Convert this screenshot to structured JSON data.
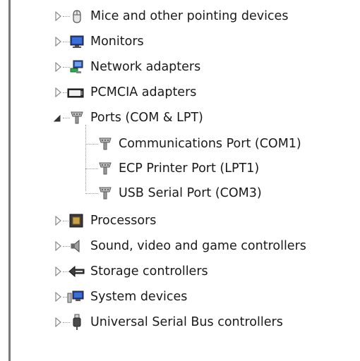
{
  "device_tree": {
    "items": [
      {
        "label": "Mice and other pointing devices",
        "icon": "mouse-icon",
        "state": "collapsed"
      },
      {
        "label": "Monitors",
        "icon": "monitor-icon",
        "state": "collapsed"
      },
      {
        "label": "Network adapters",
        "icon": "network-adapter-icon",
        "state": "collapsed"
      },
      {
        "label": "PCMCIA adapters",
        "icon": "pcmcia-icon",
        "state": "collapsed"
      },
      {
        "label": "Ports (COM & LPT)",
        "icon": "port-icon",
        "state": "expanded",
        "children": [
          {
            "label": "Communications Port (COM1)",
            "icon": "port-icon"
          },
          {
            "label": "ECP Printer Port (LPT1)",
            "icon": "port-icon"
          },
          {
            "label": "USB Serial Port (COM3)",
            "icon": "port-icon"
          }
        ]
      },
      {
        "label": "Processors",
        "icon": "processor-icon",
        "state": "collapsed"
      },
      {
        "label": "Sound, video and game controllers",
        "icon": "speaker-icon",
        "state": "collapsed"
      },
      {
        "label": "Storage controllers",
        "icon": "storage-icon",
        "state": "collapsed"
      },
      {
        "label": "System devices",
        "icon": "system-devices-icon",
        "state": "collapsed"
      },
      {
        "label": "Universal Serial Bus controllers",
        "icon": "usb-icon",
        "state": "collapsed"
      }
    ]
  }
}
